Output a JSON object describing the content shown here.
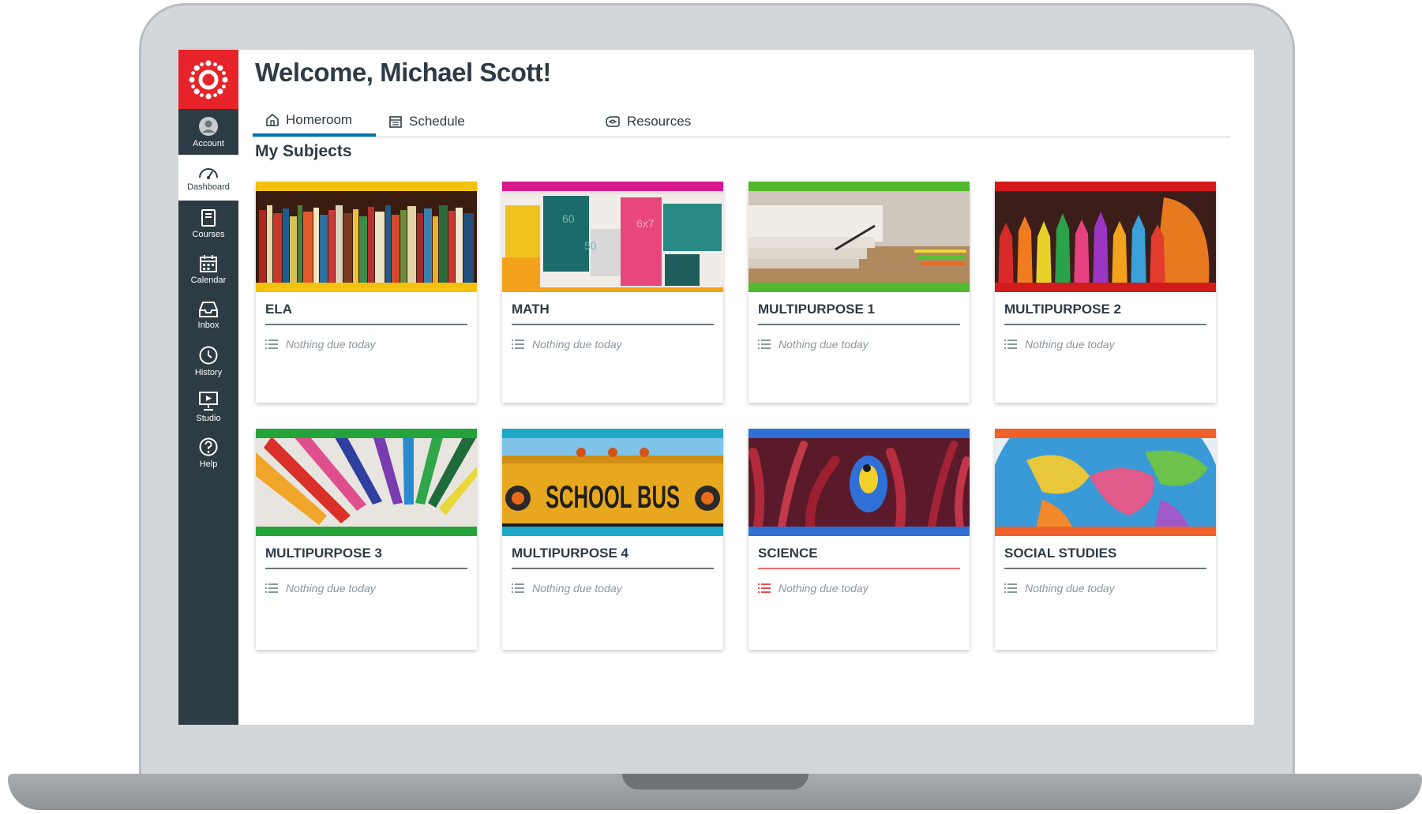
{
  "header": {
    "title": "Welcome, Michael Scott!"
  },
  "sidebar": {
    "items": [
      {
        "label": "Account",
        "icon": "account-icon"
      },
      {
        "label": "Dashboard",
        "icon": "dashboard-icon"
      },
      {
        "label": "Courses",
        "icon": "courses-icon"
      },
      {
        "label": "Calendar",
        "icon": "calendar-icon"
      },
      {
        "label": "Inbox",
        "icon": "inbox-icon"
      },
      {
        "label": "History",
        "icon": "history-icon"
      },
      {
        "label": "Studio",
        "icon": "studio-icon"
      },
      {
        "label": "Help",
        "icon": "help-icon"
      }
    ],
    "active": "Dashboard"
  },
  "tabs": [
    {
      "label": "Homeroom",
      "icon": "home-icon",
      "active": true
    },
    {
      "label": "Schedule",
      "icon": "schedule-icon",
      "active": false
    },
    {
      "label": "Resources",
      "icon": "resources-icon",
      "active": false
    }
  ],
  "section": {
    "title": "My Subjects"
  },
  "cards": [
    {
      "title": "ELA",
      "status": "Nothing due today",
      "color": "#f4c20d",
      "image": "books"
    },
    {
      "title": "MATH",
      "status": "Nothing due today",
      "color": "#d6198b",
      "image": "math-blocks"
    },
    {
      "title": "MULTIPURPOSE 1",
      "status": "Nothing due today",
      "color": "#52b82e",
      "image": "notebooks"
    },
    {
      "title": "MULTIPURPOSE 2",
      "status": "Nothing due today",
      "color": "#d41b1b",
      "image": "crayons"
    },
    {
      "title": "MULTIPURPOSE 3",
      "status": "Nothing due today",
      "color": "#24a33a",
      "image": "colored-pencils"
    },
    {
      "title": "MULTIPURPOSE 4",
      "status": "Nothing due today",
      "color": "#20a8c9",
      "image": "school-bus",
      "image_text": "SCHOOL BUS"
    },
    {
      "title": "SCIENCE",
      "status": "Nothing due today",
      "color": "#2f6fd6",
      "image": "coral-fish"
    },
    {
      "title": "SOCIAL STUDIES",
      "status": "Nothing due today",
      "color": "#f0612a",
      "image": "globe"
    }
  ],
  "colors": {
    "sidebar": "#2d3b45",
    "brand": "#e72429",
    "tab_active": "#0374b5",
    "science_rule": "#f26d6d"
  }
}
